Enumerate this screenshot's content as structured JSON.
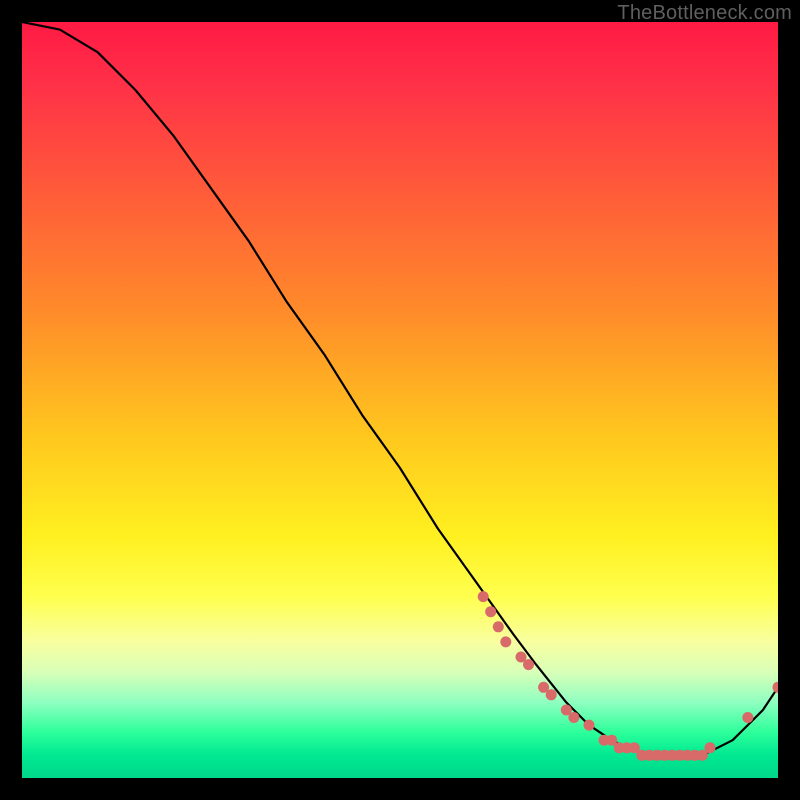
{
  "watermark": "TheBottleneck.com",
  "chart_data": {
    "type": "line",
    "title": "",
    "xlabel": "",
    "ylabel": "",
    "xlim": [
      0,
      100
    ],
    "ylim": [
      0,
      100
    ],
    "series": [
      {
        "name": "bottleneck-curve",
        "x": [
          0,
          5,
          10,
          15,
          20,
          25,
          30,
          35,
          40,
          45,
          50,
          55,
          60,
          65,
          68,
          72,
          75,
          78,
          80,
          83,
          86,
          88,
          90,
          92,
          94,
          96,
          98,
          100
        ],
        "y": [
          100,
          99,
          96,
          91,
          85,
          78,
          71,
          63,
          56,
          48,
          41,
          33,
          26,
          19,
          15,
          10,
          7,
          5,
          4,
          3,
          3,
          3,
          3,
          4,
          5,
          7,
          9,
          12
        ]
      }
    ],
    "highlight_points": {
      "name": "curve-dots",
      "color": "#d86a6a",
      "points": [
        {
          "x": 61,
          "y": 24
        },
        {
          "x": 62,
          "y": 22
        },
        {
          "x": 63,
          "y": 20
        },
        {
          "x": 64,
          "y": 18
        },
        {
          "x": 66,
          "y": 16
        },
        {
          "x": 67,
          "y": 15
        },
        {
          "x": 69,
          "y": 12
        },
        {
          "x": 70,
          "y": 11
        },
        {
          "x": 72,
          "y": 9
        },
        {
          "x": 73,
          "y": 8
        },
        {
          "x": 75,
          "y": 7
        },
        {
          "x": 77,
          "y": 5
        },
        {
          "x": 78,
          "y": 5
        },
        {
          "x": 79,
          "y": 4
        },
        {
          "x": 80,
          "y": 4
        },
        {
          "x": 81,
          "y": 4
        },
        {
          "x": 82,
          "y": 3
        },
        {
          "x": 83,
          "y": 3
        },
        {
          "x": 84,
          "y": 3
        },
        {
          "x": 85,
          "y": 3
        },
        {
          "x": 86,
          "y": 3
        },
        {
          "x": 87,
          "y": 3
        },
        {
          "x": 88,
          "y": 3
        },
        {
          "x": 89,
          "y": 3
        },
        {
          "x": 90,
          "y": 3
        },
        {
          "x": 91,
          "y": 4
        },
        {
          "x": 96,
          "y": 8
        },
        {
          "x": 100,
          "y": 12
        }
      ]
    }
  }
}
